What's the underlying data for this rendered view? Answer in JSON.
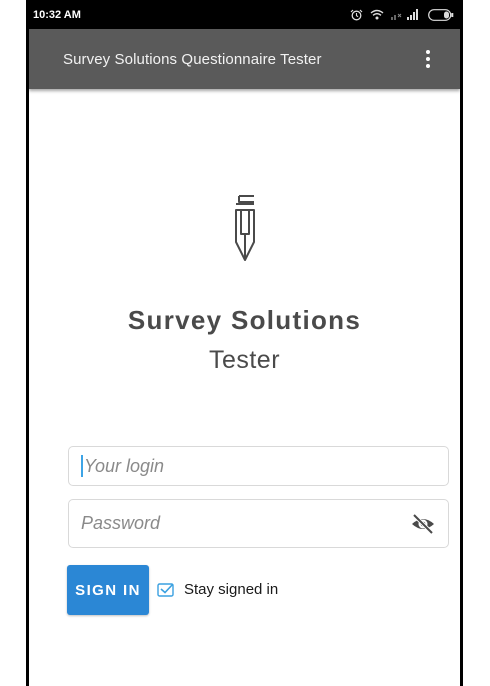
{
  "status_bar": {
    "time": "10:32 AM",
    "icons": [
      "alarm-icon",
      "wifi-icon",
      "signal-icon",
      "battery-icon"
    ]
  },
  "app_bar": {
    "title": "Survey Solutions Questionnaire Tester",
    "menu_icon": "overflow-menu-icon"
  },
  "branding": {
    "logo_icon": "pencil-logo-icon",
    "title": "Survey Solutions",
    "subtitle": "Tester"
  },
  "form": {
    "login": {
      "value": "",
      "placeholder": "Your login"
    },
    "password": {
      "value": "",
      "placeholder": "Password",
      "toggle_icon": "eye-off-icon"
    },
    "sign_in_label": "SIGN IN",
    "stay_signed_in": {
      "label": "Stay signed in",
      "checked": true
    }
  },
  "colors": {
    "app_bar": "#5a5a5a",
    "status_bar": "#000000",
    "accent": "#2b87d5",
    "brand_text": "#4a4a4a",
    "placeholder": "#8a8a8a",
    "caret": "#3da4e6"
  }
}
